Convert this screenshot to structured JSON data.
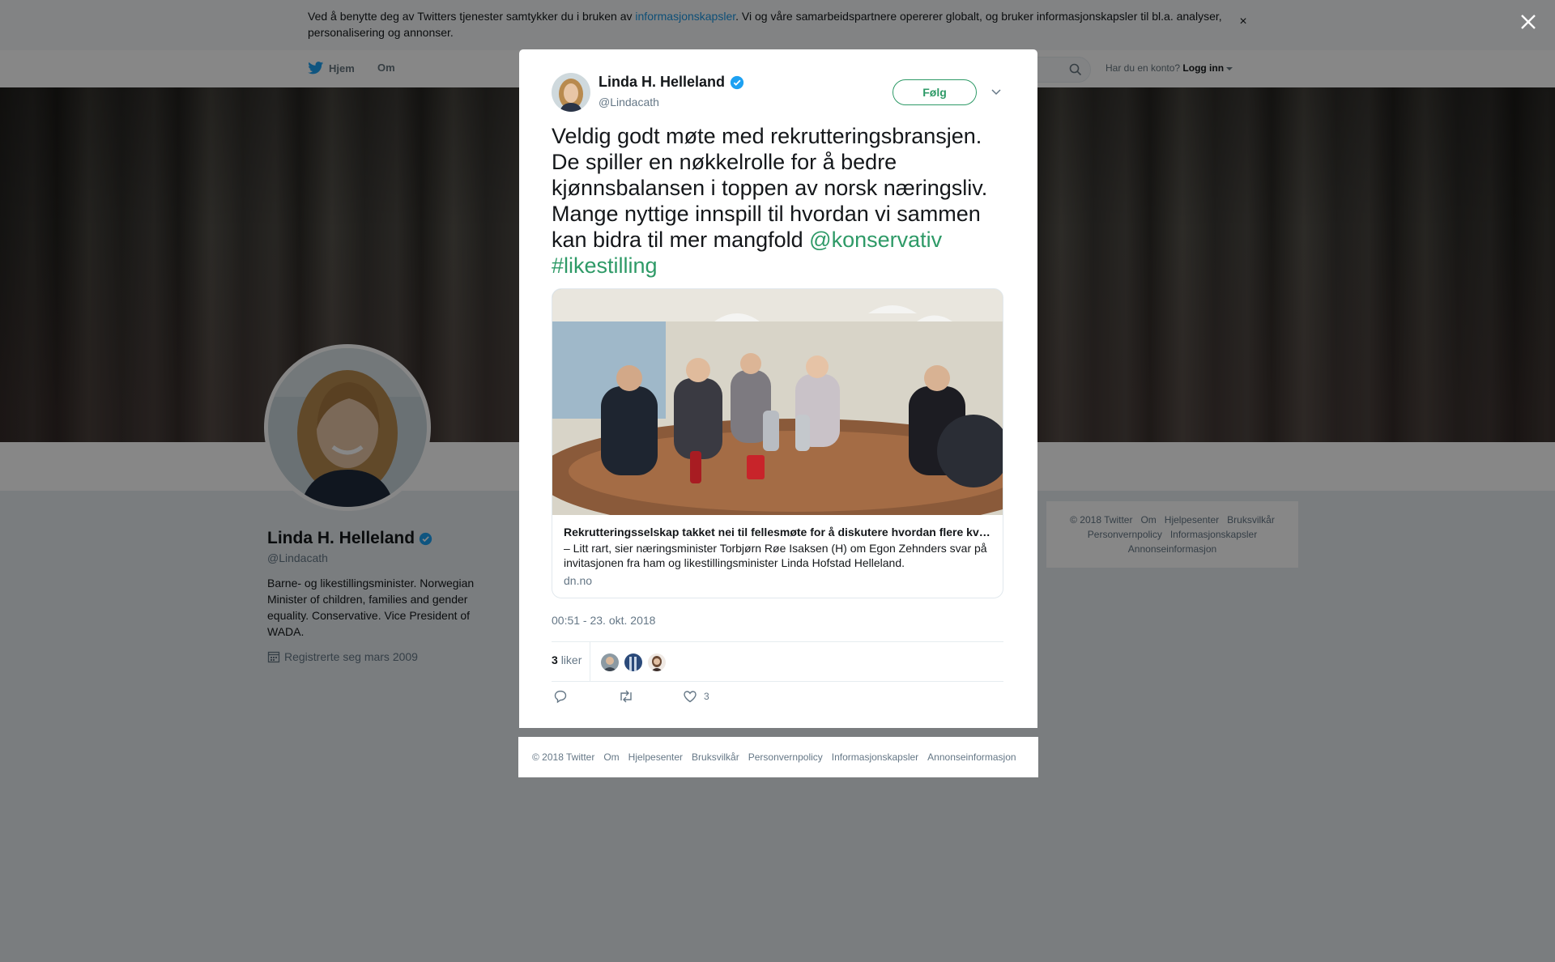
{
  "cookie": {
    "text_before": "Ved å benytte deg av Twitters tjenester samtykker du i bruken av ",
    "link": "informasjonskapsler",
    "text_after": ". Vi og våre samarbeidspartnere opererer globalt, og bruker informasjonskapsler til bl.a. analyser, personalisering og annonser.",
    "close_icon": "close-icon"
  },
  "nav": {
    "home": "Hjem",
    "about": "Om",
    "account_prompt": "Har du en konto?",
    "login": "Logg inn"
  },
  "profile": {
    "name": "Linda H. Helleland",
    "handle": "@Lindacath",
    "bio": "Barne- og likestillingsminister. Norwegian Minister of children, families and gender equality. Conservative. Vice President of WADA.",
    "joined": "Registrerte seg mars 2009"
  },
  "side_footer": [
    "© 2018 Twitter",
    "Om",
    "Hjelpesenter",
    "Bruksvilkår",
    "Personvernpolicy",
    "Informasjonskapsler",
    "Annonseinformasjon"
  ],
  "tweet": {
    "name": "Linda H. Helleland",
    "handle": "@Lindacath",
    "follow_label": "Følg",
    "text": "Veldig godt møte med rekrutteringsbransjen. De spiller en nøkkelrolle for å bedre kjønnsbalansen i toppen av norsk næringsliv. Mange nyttige innspill til hvordan vi sammen kan bidra til mer mangfold ",
    "mention": "@konservativ",
    "hashtag": "#likestilling",
    "card": {
      "title": "Rekrutteringsselskap takket nei til fellesmøte for å diskutere hvordan flere kvinner kan nå toppen",
      "description": "– Litt rart, sier næringsminister Torbjørn Røe Isaksen (H) om Egon Zehnders svar på invitasjonen fra ham og likestillingsminister Linda Hofstad Helleland.",
      "domain": "dn.no"
    },
    "timestamp": "00:51 - 23. okt. 2018",
    "likes_count": "3",
    "likes_label": "liker",
    "action_like_count": "3"
  },
  "modal_footer": [
    "© 2018 Twitter",
    "Om",
    "Hjelpesenter",
    "Bruksvilkår",
    "Personvernpolicy",
    "Informasjonskapsler",
    "Annonseinformasjon"
  ],
  "colors": {
    "accent": "#2e9a67",
    "link_blue": "#1b95e0",
    "verified": "#1da1f2",
    "overlay": "rgba(0,0,0,0.47)"
  }
}
